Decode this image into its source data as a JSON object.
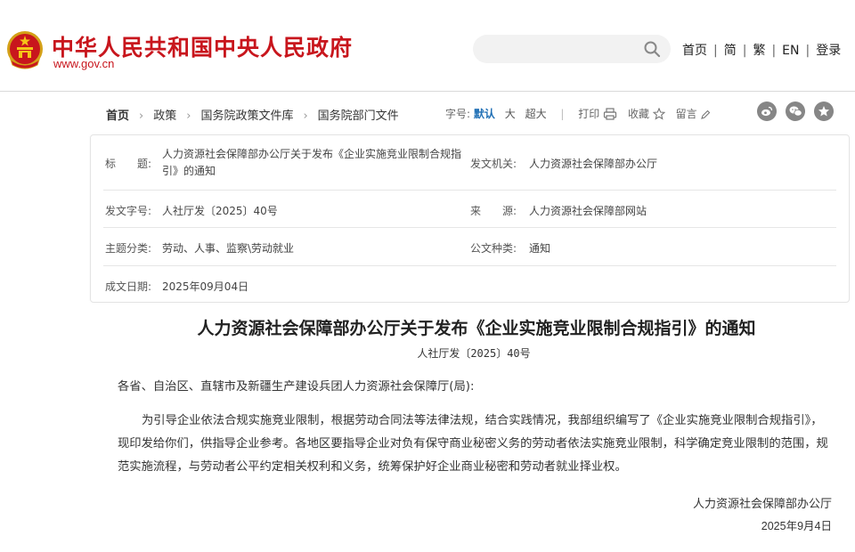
{
  "header": {
    "site_title": "中华人民共和国中央人民政府",
    "site_url": "www.gov.cn",
    "search_placeholder": "",
    "nav": [
      "首页",
      "简",
      "繁",
      "EN",
      "登录"
    ]
  },
  "breadcrumb": [
    "首页",
    "政策",
    "国务院政策文件库",
    "国务院部门文件"
  ],
  "tools": {
    "font_label": "字号:",
    "font_sizes": [
      "默认",
      "大",
      "超大"
    ],
    "font_selected": "默认",
    "print": "打印",
    "favorite": "收藏",
    "comment": "留言"
  },
  "share_icons": [
    "weibo-icon",
    "wechat-icon",
    "star-icon"
  ],
  "meta": {
    "title_label": "标　　题:",
    "title_value": "人力资源社会保障部办公厅关于发布《企业实施竞业限制合规指引》的通知",
    "issuer_label": "发文机关:",
    "issuer_value": "人力资源社会保障部办公厅",
    "docno_label": "发文字号:",
    "docno_value": "人社厅发〔2025〕40号",
    "source_label": "来　　源:",
    "source_value": "人力资源社会保障部网站",
    "topic_label": "主题分类:",
    "topic_value": "劳动、人事、监察\\劳动就业",
    "type_label": "公文种类:",
    "type_value": "通知",
    "date_label": "成文日期:",
    "date_value": "2025年09月04日"
  },
  "article": {
    "title": "人力资源社会保障部办公厅关于发布《企业实施竞业限制合规指引》的通知",
    "doc_no": "人社厅发〔2025〕40号",
    "salutation": "各省、自治区、直辖市及新疆生产建设兵团人力资源社会保障厅(局):",
    "paragraph": "为引导企业依法合规实施竞业限制，根据劳动合同法等法律法规，结合实践情况，我部组织编写了《企业实施竞业限制合规指引》，现印发给你们，供指导企业参考。各地区要指导企业对负有保守商业秘密义务的劳动者依法实施竞业限制，科学确定竞业限制的范围，规范实施流程，与劳动者公平约定相关权利和义务，统筹保护好企业商业秘密和劳动者就业择业权。",
    "signer": "人力资源社会保障部办公厅",
    "sign_date": "2025年9月4日"
  },
  "colors": {
    "brand_red": "#c8161d",
    "accent_blue": "#1f6fb5",
    "icon_grey": "#868686"
  }
}
